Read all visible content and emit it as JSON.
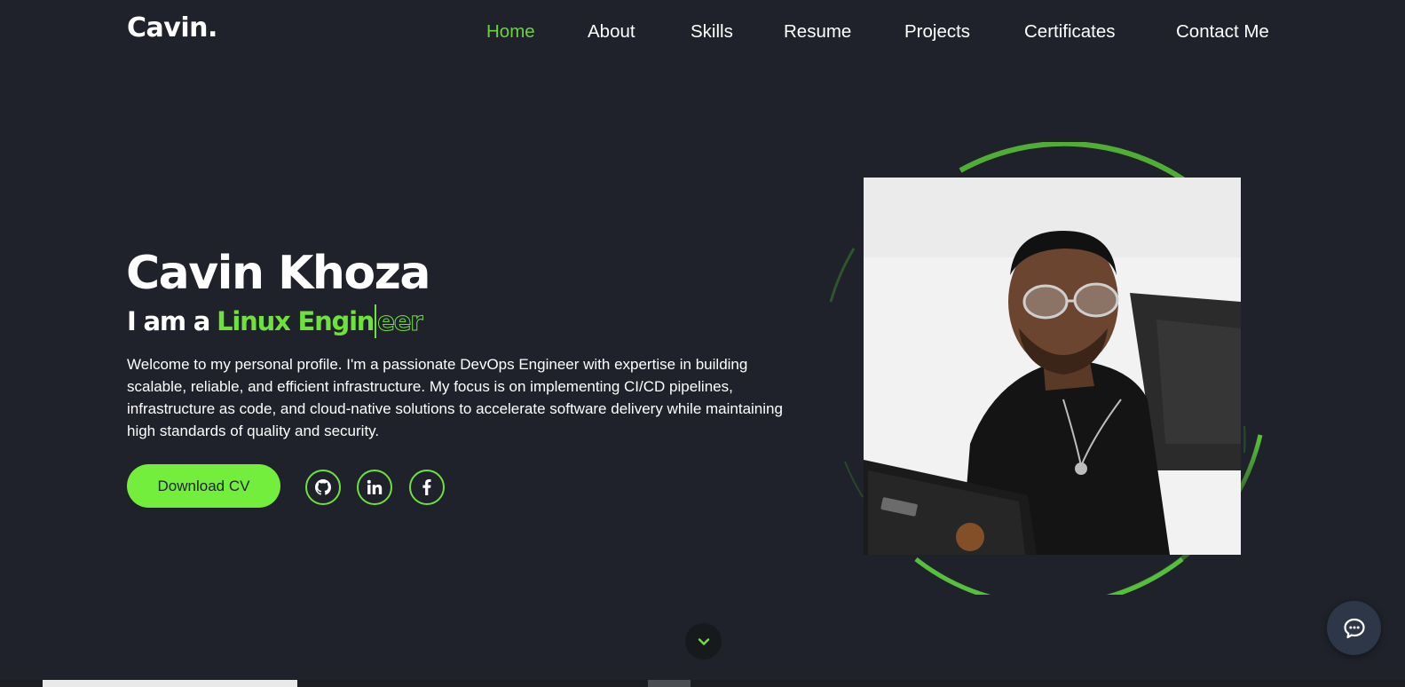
{
  "header": {
    "logo": "Cavin.",
    "nav": [
      {
        "label": "Home",
        "active": true
      },
      {
        "label": "About",
        "active": false
      },
      {
        "label": "Skills",
        "active": false
      },
      {
        "label": "Resume",
        "active": false
      },
      {
        "label": "Projects",
        "active": false
      },
      {
        "label": "Certificates",
        "active": false
      },
      {
        "label": "Contact Me",
        "active": false
      }
    ]
  },
  "hero": {
    "name": "Cavin Khoza",
    "tagline_prefix": "I am a",
    "typed_text": "Linux Engin",
    "typed_ghost": "eer",
    "bio": "Welcome to my personal profile. I'm a passionate DevOps Engineer with expertise in building scalable, reliable, and efficient infrastructure. My focus is on implementing CI/CD pipelines, infrastructure as code, and cloud-native solutions to accelerate software delivery while maintaining high standards of quality and security.",
    "download_button": "Download CV",
    "socials": [
      "github-icon",
      "linkedin-icon",
      "facebook-icon"
    ]
  },
  "colors": {
    "background": "#1f222a",
    "accent": "#6fe13d",
    "button": "#74ee3c",
    "chat_button": "#2d3748"
  }
}
